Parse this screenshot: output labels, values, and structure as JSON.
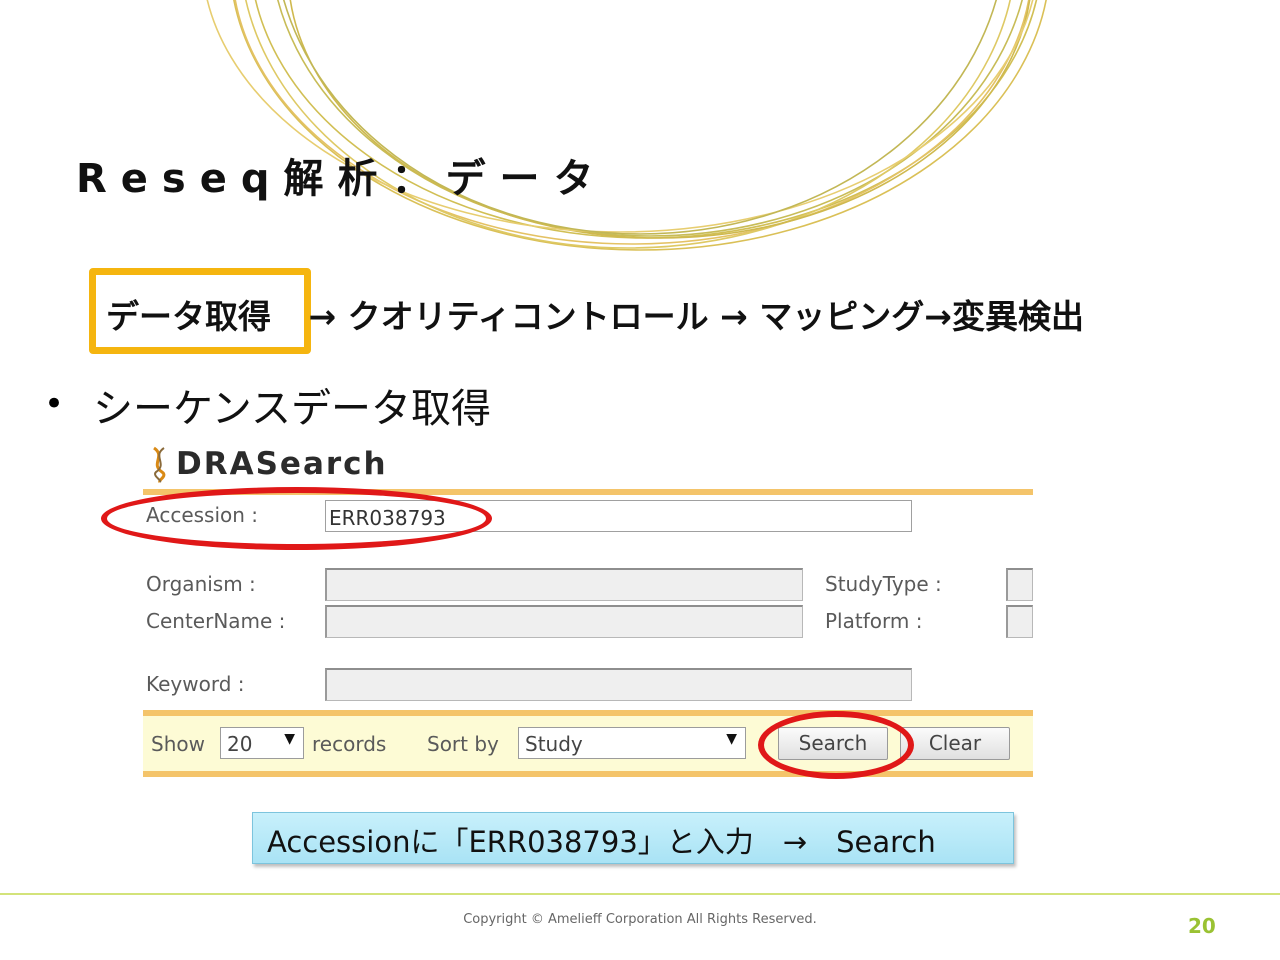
{
  "slide": {
    "title": "Reseq解析：データ",
    "steps": {
      "current": "データ取得",
      "rest": "→ クオリティコントロール → マッピング→変異検出"
    },
    "bullet": "シーケンスデータ取得"
  },
  "dra": {
    "logo": "DRASearch",
    "accession_label": "Accession :",
    "accession_value": "ERR038793",
    "organism_label": "Organism :",
    "centername_label": "CenterName :",
    "studytype_label": "StudyType :",
    "platform_label": "Platform :",
    "keyword_label": "Keyword :",
    "show_label": "Show",
    "show_value": "20",
    "records_label": "records",
    "sortby_label": "Sort by",
    "sortby_value": "Study",
    "search_button": "Search",
    "clear_button": "Clear"
  },
  "callout": "Accessionに「ERR038793」と入力　→　Search",
  "footer": {
    "copyright": "Copyright © Amelieff Corporation All Rights Reserved.",
    "page_number": "20"
  },
  "colors": {
    "highlight_box": "#f5b50f",
    "annotation_ring": "#e01818",
    "bar_stripe": "#f4c46a",
    "callout_fill": "#b8e9f8",
    "page_number": "#9ac233",
    "decor_rings": "#d4b63a"
  },
  "icons": {
    "logo_icon": "dna-helix-icon",
    "select_caret": "dropdown-caret-icon"
  }
}
